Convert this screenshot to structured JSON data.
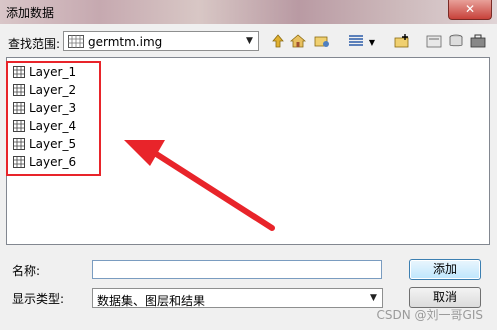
{
  "window": {
    "title": "添加数据",
    "close_symbol": "✕"
  },
  "lookin": {
    "label": "查找范围:",
    "value": "germtm.img"
  },
  "toolbar": {
    "icons": [
      "up-level-icon",
      "home-icon",
      "connect-folder-icon",
      "view-list-icon",
      "view-dropdown-icon",
      "new-connection-icon",
      "catalog-icon",
      "database-icon",
      "toolbox-icon"
    ]
  },
  "layers": [
    "Layer_1",
    "Layer_2",
    "Layer_3",
    "Layer_4",
    "Layer_5",
    "Layer_6"
  ],
  "name_field": {
    "label": "名称:",
    "value": ""
  },
  "type_field": {
    "label": "显示类型:",
    "value": "数据集、图层和结果"
  },
  "buttons": {
    "add": "添加",
    "cancel": "取消"
  },
  "watermark": "CSDN @刘一哥GIS",
  "colors": {
    "highlight": "#e8242a",
    "arrow": "#e8242a"
  }
}
